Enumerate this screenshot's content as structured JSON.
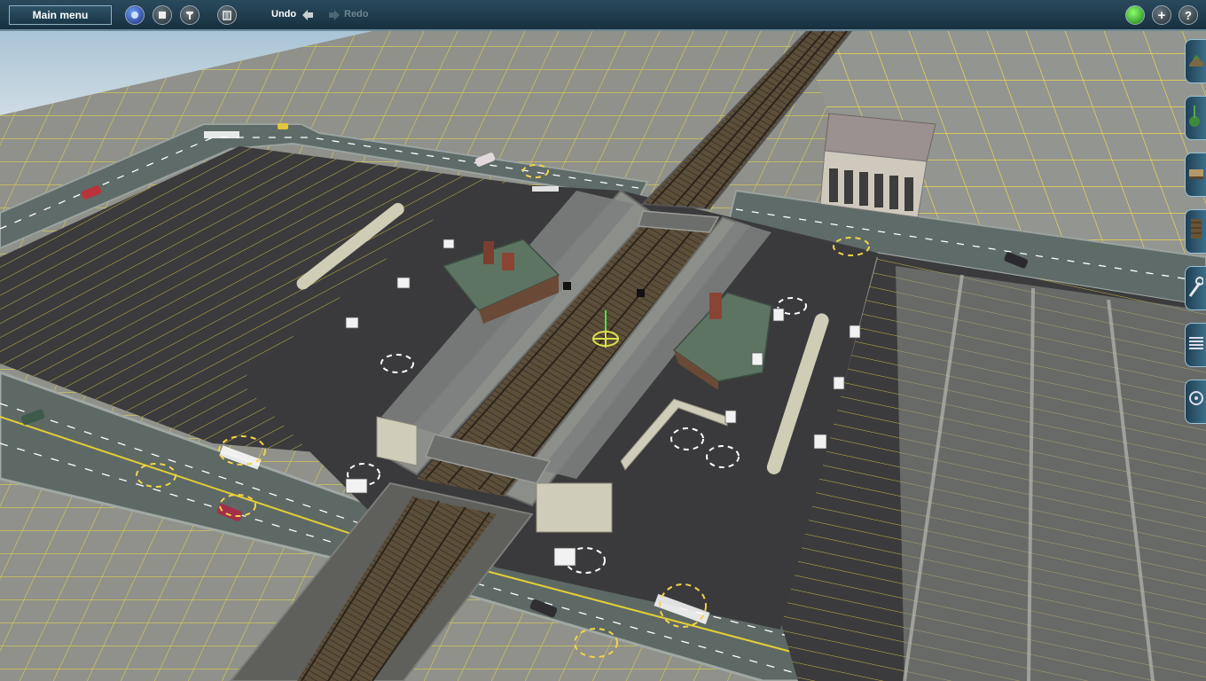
{
  "toolbar": {
    "main_menu_label": "Main menu",
    "undo_label": "Undo",
    "redo_label": "Redo",
    "left_icons": [
      "driver-mode-icon",
      "stop-icon",
      "time-icon",
      "bin-icon"
    ],
    "right_icons": [
      "status-light-icon",
      "add-icon",
      "help-icon"
    ],
    "help_glyph": "?",
    "add_glyph": "+"
  },
  "side_panel": {
    "tools": [
      "terrain-tool-icon",
      "trees-tool-icon",
      "objects-tool-icon",
      "track-tool-icon",
      "wrench-tool-icon",
      "layers-tool-icon",
      "settings-wheel-icon"
    ]
  },
  "colors": {
    "toolbar_top": "#2a4a5c",
    "grid_line": "#d8c84a",
    "road": "#5d6a67",
    "parking": "#3a3a3c",
    "platform": "#8a8c88",
    "track_bed": "#6b5f45"
  }
}
